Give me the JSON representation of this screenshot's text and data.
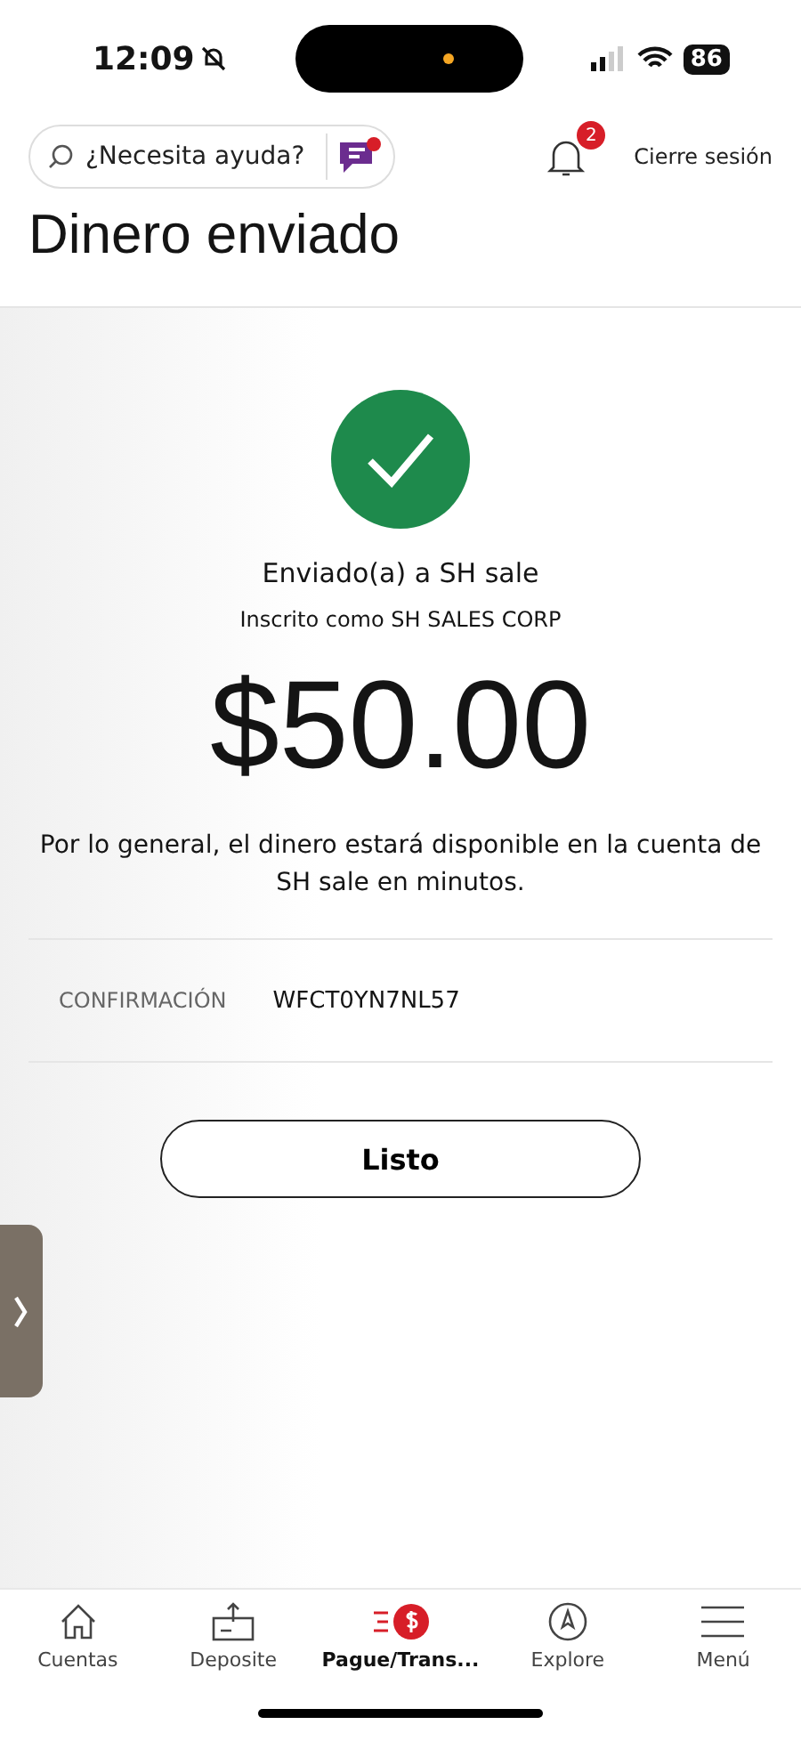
{
  "status_bar": {
    "time": "12:09",
    "battery": "86"
  },
  "header": {
    "search": {
      "placeholder": "¿Necesita ayuda?"
    },
    "notifications": {
      "count": "2"
    },
    "logout": "Cierre sesión"
  },
  "title": "Dinero enviado",
  "result": {
    "recipient": "Enviado(a) a SH sale",
    "enrolled": "Inscrito como SH SALES CORP",
    "amount": "$50.00",
    "note": "Por lo general, el dinero estará disponible en la cuenta de SH sale en minutos."
  },
  "confirmation": {
    "label": "CONFIRMACIÓN",
    "value": "WFCT0YN7NL57"
  },
  "done_button": "Listo",
  "nav": [
    {
      "kind": "home",
      "label": "Cuentas",
      "selected": false
    },
    {
      "kind": "deposit",
      "label": "Deposite",
      "selected": false
    },
    {
      "kind": "pay",
      "label": "Pague/Trans...",
      "selected": true
    },
    {
      "kind": "explore",
      "label": "Explore",
      "selected": false
    },
    {
      "kind": "menu",
      "label": "Menú",
      "selected": false
    }
  ]
}
